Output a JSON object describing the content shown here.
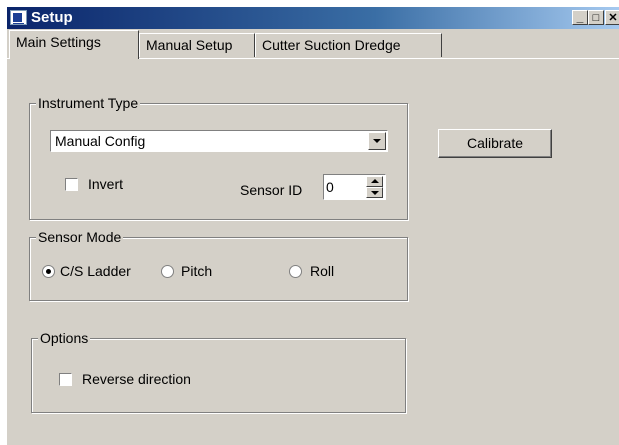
{
  "window": {
    "title": "Setup",
    "min_glyph": "_",
    "max_glyph": "□",
    "close_glyph": "✕"
  },
  "tabs": [
    {
      "label": "Main Settings"
    },
    {
      "label": "Manual Setup"
    },
    {
      "label": "Cutter Suction Dredge"
    }
  ],
  "instrument_type": {
    "legend": "Instrument Type",
    "selected": "Manual Config",
    "invert_label": "Invert",
    "invert_checked": false,
    "sensor_id_label": "Sensor ID",
    "sensor_id_value": "0"
  },
  "calibrate_label": "Calibrate",
  "sensor_mode": {
    "legend": "Sensor Mode",
    "options": [
      {
        "label": "C/S Ladder",
        "selected": true
      },
      {
        "label": "Pitch",
        "selected": false
      },
      {
        "label": "Roll",
        "selected": false
      }
    ]
  },
  "options": {
    "legend": "Options",
    "reverse_label": "Reverse direction",
    "reverse_checked": false
  }
}
